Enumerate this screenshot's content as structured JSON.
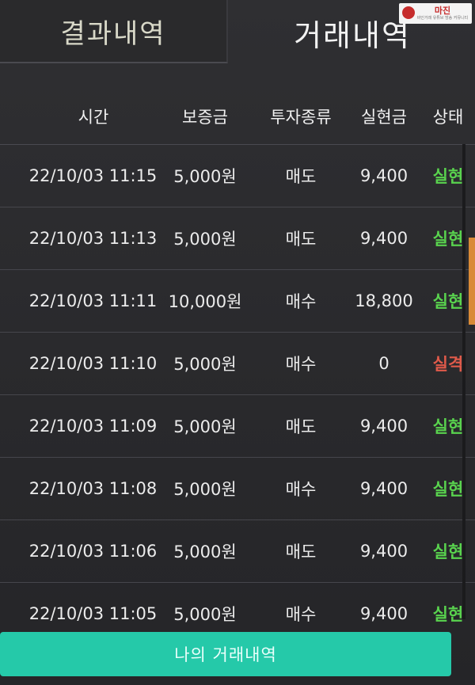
{
  "tabs": {
    "left_label": "결과내역",
    "right_label": "거래내역"
  },
  "logo": {
    "name": "마진",
    "sub": "바인거래 유튜브 방송 커뮤니티"
  },
  "table": {
    "headers": {
      "time": "시간",
      "deposit": "보증금",
      "type": "투자종류",
      "realized": "실현금",
      "status": "상태"
    },
    "rows": [
      {
        "time": "22/10/03 11:15",
        "deposit": "5,000원",
        "type": "매도",
        "realized": "9,400",
        "status": "실현"
      },
      {
        "time": "22/10/03 11:13",
        "deposit": "5,000원",
        "type": "매도",
        "realized": "9,400",
        "status": "실현"
      },
      {
        "time": "22/10/03 11:11",
        "deposit": "10,000원",
        "type": "매수",
        "realized": "18,800",
        "status": "실현"
      },
      {
        "time": "22/10/03 11:10",
        "deposit": "5,000원",
        "type": "매수",
        "realized": "0",
        "status": "실격"
      },
      {
        "time": "22/10/03 11:09",
        "deposit": "5,000원",
        "type": "매도",
        "realized": "9,400",
        "status": "실현"
      },
      {
        "time": "22/10/03 11:08",
        "deposit": "5,000원",
        "type": "매수",
        "realized": "9,400",
        "status": "실현"
      },
      {
        "time": "22/10/03 11:06",
        "deposit": "5,000원",
        "type": "매도",
        "realized": "9,400",
        "status": "실현"
      },
      {
        "time": "22/10/03 11:05",
        "deposit": "5,000원",
        "type": "매수",
        "realized": "9,400",
        "status": "실현"
      }
    ]
  },
  "footer": {
    "my_trades_label": "나의 거래내역"
  },
  "colors": {
    "success": "#59d34e",
    "fail": "#e05a4a",
    "accent": "#25c9a9"
  }
}
